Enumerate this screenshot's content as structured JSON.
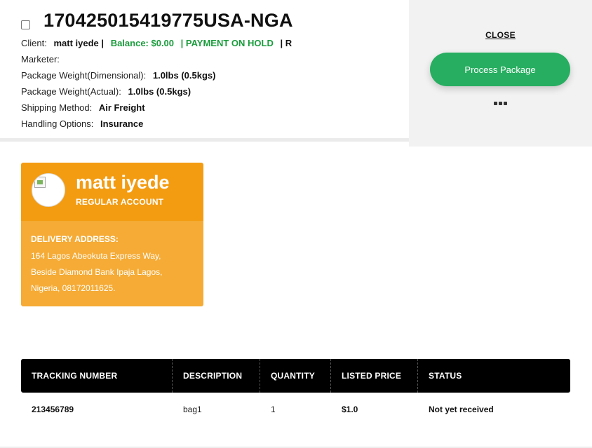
{
  "package": {
    "id": "170425015419775USA-NGA",
    "client_label": "Client:",
    "client_name": "matt iyede",
    "sep1": "|",
    "balance": "Balance: $0.00",
    "status": "| PAYMENT ON HOLD",
    "sep2": "| R",
    "marketer_label": "Marketer:",
    "dim_weight_label": "Package Weight(Dimensional):",
    "dim_weight": "1.0lbs (0.5kgs)",
    "actual_weight_label": "Package Weight(Actual):",
    "actual_weight": "1.0lbs (0.5kgs)",
    "shipping_label": "Shipping Method:",
    "shipping": "Air Freight",
    "handling_label": "Handling Options:",
    "handling": "Insurance",
    "status_color": "#1a9c3c"
  },
  "actions": {
    "close": "CLOSE",
    "process": "Process Package",
    "more_icon": "more-dots-icon",
    "process_color": "#27ae60"
  },
  "customer": {
    "name": "matt iyede",
    "account_type": "REGULAR ACCOUNT",
    "address_label": "DELIVERY ADDRESS:",
    "address": "164 Lagos Abeokuta Express Way, Beside Diamond Bank Ipaja Lagos, Nigeria, 08172011625.",
    "card_color": "#f39c12"
  },
  "table": {
    "headers": [
      "TRACKING NUMBER",
      "DESCRIPTION",
      "QUANTITY",
      "LISTED PRICE",
      "STATUS"
    ],
    "rows": [
      [
        "213456789",
        "bag1",
        "1",
        "$1.0",
        "Not yet received"
      ]
    ]
  }
}
